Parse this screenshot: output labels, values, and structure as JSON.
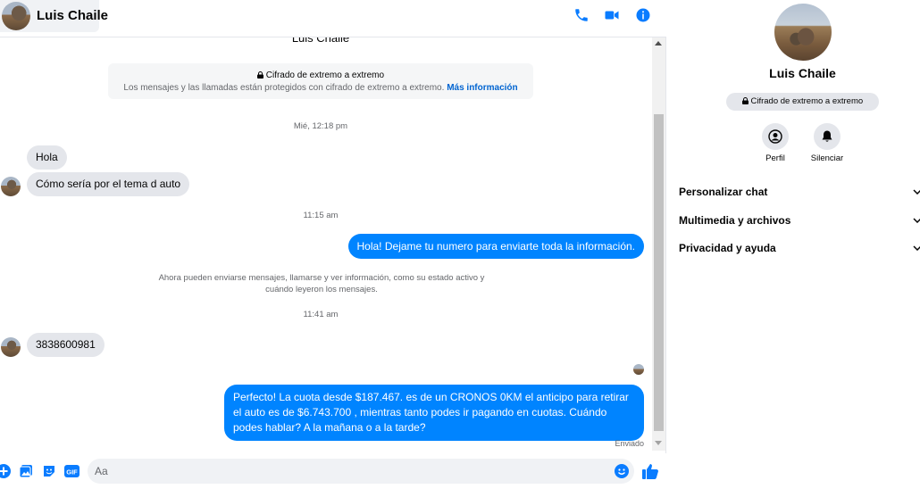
{
  "header": {
    "contact_name": "Luis Chaile"
  },
  "conversation": {
    "top_name": "Luis Chaile",
    "e2e_title": "Cifrado de extremo a extremo",
    "e2e_desc": "Los mensajes y las llamadas están protegidos con cifrado de extremo a extremo.",
    "e2e_link": "Más información",
    "messages": [
      {
        "type": "timestamp",
        "text": "Mié, 12:18 pm"
      },
      {
        "type": "incoming",
        "text": "Hola"
      },
      {
        "type": "incoming",
        "text": "Cómo sería por el tema d auto"
      },
      {
        "type": "timestamp",
        "text": "11:15 am"
      },
      {
        "type": "outgoing",
        "text": "Hola! Dejame tu numero  para enviarte toda la información."
      },
      {
        "type": "info",
        "text": "Ahora pueden enviarse mensajes, llamarse y ver información, como su estado activo y cuándo leyeron los mensajes."
      },
      {
        "type": "timestamp",
        "text": "11:41 am"
      },
      {
        "type": "incoming",
        "text": "3838600981"
      },
      {
        "type": "outgoing",
        "text": "Perfecto! La cuota desde $187.467. es de un CRONOS 0KM el anticipo para retirar el auto es de $6.743.700 , mientras tanto podes ir pagando en cuotas. Cuándo podes hablar? A la mañana o a la tarde?"
      }
    ],
    "sent_status": "Enviado"
  },
  "composer": {
    "placeholder": "Aa"
  },
  "details": {
    "name": "Luis Chaile",
    "e2e_pill": "Cifrado de extremo a extremo",
    "actions": [
      {
        "label": "Perfil",
        "icon": "profile-icon"
      },
      {
        "label": "Silenciar",
        "icon": "bell-icon"
      }
    ],
    "sections": [
      {
        "label": "Personalizar chat"
      },
      {
        "label": "Multimedia y archivos"
      },
      {
        "label": "Privacidad y ayuda"
      }
    ]
  },
  "colors": {
    "accent": "#0084ff",
    "icon_blue": "#0a7cff",
    "incoming_bubble": "#e4e6eb",
    "link": "#0064d1"
  }
}
